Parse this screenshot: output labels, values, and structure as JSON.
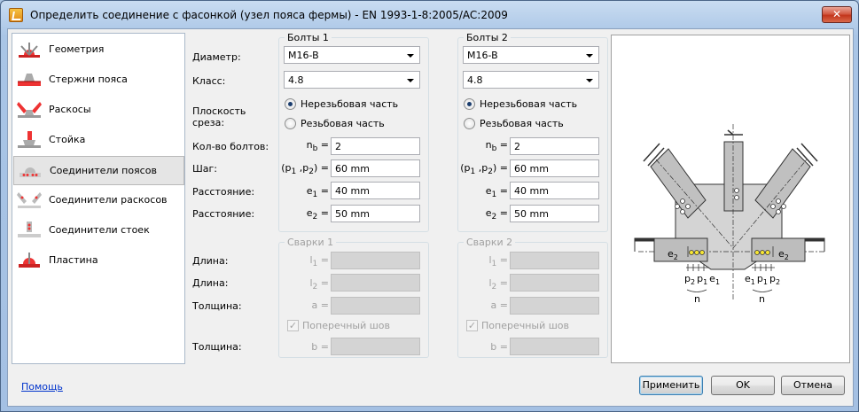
{
  "window": {
    "title": "Определить соединение с фасонкой (узел пояса фермы) - EN 1993-1-8:2005/AC:2009",
    "close": "✕"
  },
  "nav": {
    "items": [
      {
        "label": "Геометрия",
        "icon": "geometry-icon"
      },
      {
        "label": "Стержни пояса",
        "icon": "chord-members-icon"
      },
      {
        "label": "Раскосы",
        "icon": "diagonals-icon"
      },
      {
        "label": "Стойка",
        "icon": "post-icon"
      },
      {
        "label": "Соединители поясов",
        "icon": "chord-connectors-icon",
        "selected": true
      },
      {
        "label": "Соединители раскосов",
        "icon": "diagonal-connectors-icon"
      },
      {
        "label": "Соединители стоек",
        "icon": "post-connectors-icon"
      },
      {
        "label": "Пластина",
        "icon": "plate-icon"
      }
    ]
  },
  "labels": {
    "diameter": "Диаметр:",
    "class": "Класс:",
    "shear_plane_1": "Плоскость",
    "shear_plane_2": "среза:",
    "bolt_count": "Кол-во болтов:",
    "pitch": "Шаг:",
    "distance1": "Расстояние:",
    "distance2": "Расстояние:",
    "length1": "Длина:",
    "length2": "Длина:",
    "thickness1": "Толщина:",
    "thickness2": "Толщина:"
  },
  "bolts1": {
    "title": "Болты 1",
    "diameter": "M16-B",
    "class": "4.8",
    "radio_unthreaded": "Нерезьбовая часть",
    "radio_threaded": "Резьбовая часть",
    "nb": "2",
    "pitch": "60 mm",
    "e1": "40 mm",
    "e2": "50 mm"
  },
  "bolts2": {
    "title": "Болты 2",
    "diameter": "M16-B",
    "class": "4.8",
    "radio_unthreaded": "Нерезьбовая часть",
    "radio_threaded": "Резьбовая часть",
    "nb": "2",
    "pitch": "60 mm",
    "e1": "40 mm",
    "e2": "50 mm"
  },
  "symbols": {
    "nb": "n",
    "nb_sub": "b",
    "nb_eq": " =",
    "p_open": "(p",
    "p1_sub": "1",
    "p_comma": " ,p",
    "p2_sub": "2",
    "p_close": ") =",
    "e": "e",
    "e1_sub": "1",
    "e2_sub": "2",
    "eq": " =",
    "l": "l",
    "l1_sub": "1",
    "l2_sub": "2",
    "a": "a =",
    "b": "b ="
  },
  "welds1": {
    "title": "Сварки 1",
    "transverse": "Поперечный шов"
  },
  "welds2": {
    "title": "Сварки 2",
    "transverse": "Поперечный шов"
  },
  "drawing": {
    "e2": "e",
    "sub2": "2",
    "p": "p",
    "sub1": "1",
    "n": "n"
  },
  "footer": {
    "help": "Помощь",
    "apply": "Применить",
    "ok": "OK",
    "cancel": "Отмена"
  }
}
